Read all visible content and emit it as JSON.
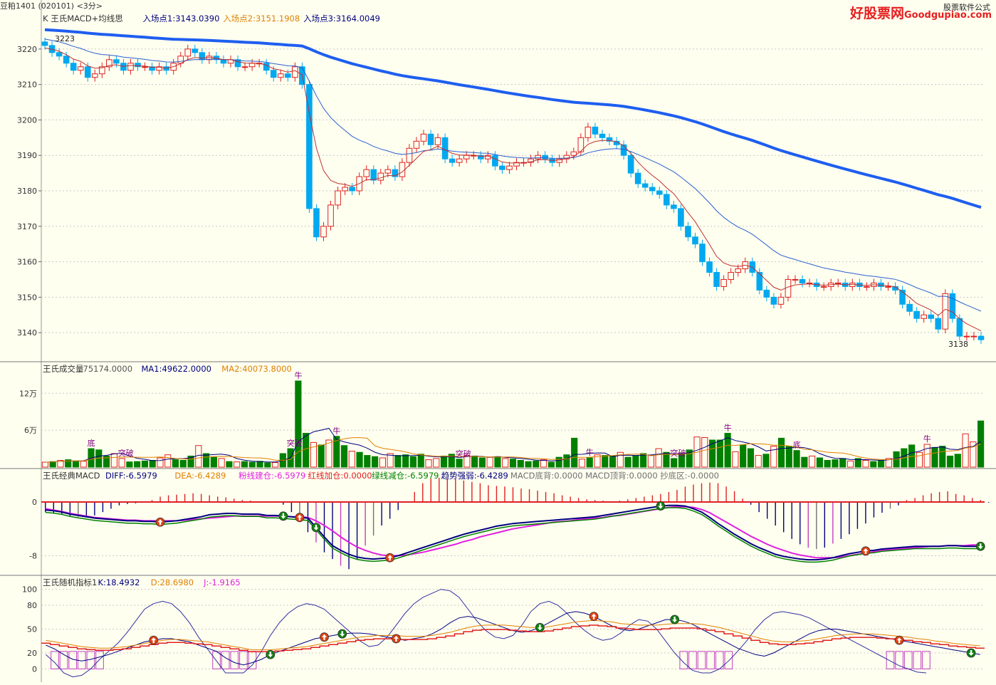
{
  "header": {
    "symbol": "豆粕1401",
    "code": "(020101)",
    "period": "<3分>",
    "watermark_brand": "好股票网",
    "watermark_url": "Goodgupiao.com",
    "watermark_sub": "股票软件公式"
  },
  "colors": {
    "up": "#e02020",
    "down": "#00a8f0",
    "volume_down": "#008000",
    "ma_long": "#1e5ef0",
    "ma_mid": "#2a5fd0",
    "ma_short": "#c03030",
    "grid": "#c8c8c8",
    "pink": "#e020e0",
    "orange": "#e08000",
    "navy": "#000080",
    "purple": "#c040c0"
  },
  "panels": {
    "price": {
      "title": "K  王氏MACD+均线思",
      "legend": [
        {
          "text": "入场点1:3143.0390",
          "color": "#000080"
        },
        {
          "text": "入场点2:3151.1908",
          "color": "#e08000"
        },
        {
          "text": "入场点3:3164.0049",
          "color": "#000080"
        }
      ],
      "yticks": [
        "3220",
        "3210",
        "3200",
        "3190",
        "3180",
        "3170",
        "3160",
        "3150",
        "3140"
      ],
      "high_label": "3223",
      "low_label": "3138"
    },
    "volume": {
      "title": "王氏成交量",
      "legend": [
        {
          "text": "75174.0000",
          "color": "#555555"
        },
        {
          "text": "MA1:49622.0000",
          "color": "#000080"
        },
        {
          "text": "MA2:40073.8000",
          "color": "#e08000"
        }
      ],
      "yticks": [
        "12万",
        "6万"
      ]
    },
    "macd": {
      "title": "王氏经典MACD",
      "legend": [
        {
          "text": "DIFF:-6.5979",
          "color": "#000080"
        },
        {
          "text": "DEA:-6.4289",
          "color": "#e08000"
        },
        {
          "text": "粉线建仓:-6.5979",
          "color": "#e020e0"
        },
        {
          "text": "红线加仓:0.0000",
          "color": "#e02020"
        },
        {
          "text": "绿线减仓:-6.5979",
          "color": "#008000"
        },
        {
          "text": "趋势强弱:-6.4289",
          "color": "#000080"
        },
        {
          "text": "MACD底背:0.0000",
          "color": "#707070"
        },
        {
          "text": "MACD顶背:0.0000",
          "color": "#707070"
        },
        {
          "text": "抄底区:-0.0000",
          "color": "#707070"
        }
      ],
      "yticks": [
        "0",
        "-8"
      ]
    },
    "kdj": {
      "title": "王氏随机指标1",
      "legend": [
        {
          "text": "K:18.4932",
          "color": "#000080"
        },
        {
          "text": "D:28.6980",
          "color": "#e08000"
        },
        {
          "text": "J:-1.9165",
          "color": "#e020e0"
        }
      ],
      "yticks": [
        "100",
        "80",
        "50",
        "20",
        "0"
      ]
    }
  },
  "signals": {
    "price_labels": [],
    "volume_labels": [
      "底",
      "牛",
      "牛",
      "突破",
      "突破",
      "突破",
      "突破",
      "牛",
      "牛",
      "底",
      "牛"
    ]
  },
  "chart_data": [
    {
      "type": "candlestick",
      "title": "",
      "ylim": [
        3133,
        3227
      ],
      "ylabel": "",
      "ticks": [
        3220,
        3210,
        3200,
        3190,
        3180,
        3170,
        3160,
        3150,
        3140
      ],
      "max_price": 3223,
      "min_price": 3138,
      "closes": [
        3221,
        3219,
        3218,
        3216,
        3214,
        3215,
        3212,
        3213,
        3215,
        3217,
        3216,
        3214,
        3216,
        3215,
        3215,
        3214,
        3215,
        3214,
        3216,
        3218,
        3220,
        3219,
        3217,
        3218,
        3217,
        3216,
        3217,
        3215,
        3215,
        3216,
        3216,
        3214,
        3212,
        3213,
        3212,
        3215,
        3210,
        3175,
        3167,
        3170,
        3176,
        3180,
        3181,
        3180,
        3184,
        3186,
        3183,
        3185,
        3186,
        3184,
        3188,
        3192,
        3194,
        3196,
        3193,
        3195,
        3189,
        3188,
        3189,
        3190,
        3190,
        3189,
        3190,
        3187,
        3186,
        3187,
        3188,
        3188,
        3189,
        3190,
        3189,
        3188,
        3189,
        3190,
        3191,
        3195,
        3198,
        3196,
        3195,
        3194,
        3193,
        3190,
        3185,
        3182,
        3181,
        3180,
        3179,
        3176,
        3175,
        3170,
        3167,
        3165,
        3160,
        3157,
        3153,
        3155,
        3157,
        3158,
        3160,
        3157,
        3152,
        3150,
        3148,
        3150,
        3155,
        3155,
        3154,
        3154,
        3153,
        3153,
        3154,
        3154,
        3153,
        3154,
        3153,
        3153,
        3154,
        3153,
        3153,
        3152,
        3148,
        3146,
        3144,
        3145,
        3144,
        3141,
        3151,
        3144,
        3139,
        3139,
        3139,
        3138
      ]
    },
    {
      "type": "bar",
      "title": "王氏成交量",
      "ylim": [
        0,
        155000
      ],
      "values": [
        8000,
        9000,
        11000,
        12000,
        10000,
        9500,
        30000,
        28000,
        18000,
        22000,
        14000,
        8500,
        9000,
        10000,
        11000,
        15000,
        20000,
        12000,
        11000,
        18000,
        35000,
        22000,
        16000,
        14000,
        9000,
        8500,
        9000,
        8000,
        9500,
        7000,
        7500,
        22000,
        30000,
        140000,
        55000,
        40000,
        36000,
        44000,
        50000,
        35000,
        26000,
        24000,
        19000,
        17000,
        15000,
        22000,
        19000,
        20000,
        17000,
        21000,
        12000,
        14000,
        18000,
        21000,
        13000,
        19000,
        18000,
        15000,
        16000,
        17000,
        14000,
        13000,
        11000,
        9000,
        10000,
        12000,
        8000,
        16000,
        20000,
        47000,
        13000,
        15000,
        20000,
        19000,
        18000,
        24000,
        16000,
        18000,
        22000,
        19000,
        30000,
        24000,
        14000,
        22000,
        28000,
        49000,
        48000,
        44000,
        44000,
        55000,
        25000,
        36000,
        30000,
        19000,
        21000,
        34000,
        47000,
        34000,
        27000,
        16000,
        18000,
        15000,
        11000,
        12000,
        14000,
        10000,
        14000,
        11000,
        9000,
        11000,
        14000,
        25000,
        30000,
        36000,
        24000,
        37000,
        32000,
        34000,
        18000,
        21000,
        54000,
        41000,
        75000
      ]
    },
    {
      "type": "line",
      "title": "王氏经典MACD",
      "ylim": [
        -10.5,
        3.5
      ],
      "series": [
        {
          "name": "DIFF",
          "values": [
            -1.2,
            -1.3,
            -1.5,
            -1.8,
            -2.0,
            -2.2,
            -2.4,
            -2.5,
            -2.6,
            -2.7,
            -2.8,
            -2.8,
            -2.9,
            -2.9,
            -3.0,
            -2.9,
            -2.8,
            -2.6,
            -2.4,
            -2.2,
            -1.9,
            -1.8,
            -1.7,
            -1.7,
            -1.8,
            -1.8,
            -1.8,
            -2.0,
            -2.0,
            -2.1,
            -2.2,
            -2.3,
            -2.4,
            -3.8,
            -5.2,
            -6.5,
            -7.2,
            -7.8,
            -8.2,
            -8.4,
            -8.5,
            -8.4,
            -8.3,
            -8.0,
            -7.6,
            -7.2,
            -6.8,
            -6.4,
            -6.0,
            -5.6,
            -5.2,
            -4.8,
            -4.5,
            -4.2,
            -3.9,
            -3.6,
            -3.4,
            -3.2,
            -3.1,
            -3.0,
            -2.9,
            -2.8,
            -2.7,
            -2.6,
            -2.5,
            -2.4,
            -2.3,
            -2.2,
            -2.0,
            -1.8,
            -1.6,
            -1.4,
            -1.2,
            -1.0,
            -0.8,
            -0.6,
            -0.5,
            -0.5,
            -0.6,
            -1.0,
            -1.5,
            -2.3,
            -3.2,
            -4.0,
            -4.8,
            -5.5,
            -6.2,
            -6.8,
            -7.3,
            -7.8,
            -8.1,
            -8.3,
            -8.5,
            -8.6,
            -8.6,
            -8.5,
            -8.3,
            -8.0,
            -7.7,
            -7.5,
            -7.3,
            -7.2,
            -7.0,
            -6.9,
            -6.8,
            -6.7,
            -6.6,
            -6.6,
            -6.6,
            -6.6,
            -6.5,
            -6.5,
            -6.6,
            -6.6,
            -6.6
          ]
        },
        {
          "name": "DEA",
          "values": [
            -1.0,
            -1.2,
            -1.4,
            -1.7,
            -1.9,
            -2.1,
            -2.3,
            -2.4,
            -2.5,
            -2.6,
            -2.7,
            -2.7,
            -2.8,
            -2.8,
            -2.8,
            -2.8,
            -2.8,
            -2.7,
            -2.6,
            -2.5,
            -2.4,
            -2.3,
            -2.2,
            -2.1,
            -2.1,
            -2.1,
            -2.1,
            -2.1,
            -2.1,
            -2.1,
            -2.2,
            -2.2,
            -2.3,
            -2.8,
            -3.5,
            -4.3,
            -5.2,
            -6.0,
            -6.7,
            -7.2,
            -7.6,
            -7.9,
            -8.0,
            -8.0,
            -7.9,
            -7.7,
            -7.5,
            -7.2,
            -6.9,
            -6.6,
            -6.3,
            -5.9,
            -5.6,
            -5.2,
            -4.9,
            -4.6,
            -4.3,
            -4.0,
            -3.8,
            -3.6,
            -3.4,
            -3.2,
            -3.0,
            -2.9,
            -2.8,
            -2.6,
            -2.5,
            -2.4,
            -2.3,
            -2.1,
            -2.0,
            -1.8,
            -1.6,
            -1.4,
            -1.2,
            -1.0,
            -0.8,
            -0.7,
            -0.7,
            -0.8,
            -1.1,
            -1.6,
            -2.3,
            -3.0,
            -3.7,
            -4.4,
            -5.1,
            -5.7,
            -6.3,
            -6.8,
            -7.2,
            -7.6,
            -7.9,
            -8.1,
            -8.3,
            -8.3,
            -8.3,
            -8.2,
            -8.0,
            -7.8,
            -7.6,
            -7.4,
            -7.2,
            -7.1,
            -7.0,
            -6.9,
            -6.8,
            -6.7,
            -6.6,
            -6.6,
            -6.5,
            -6.5,
            -6.5,
            -6.4,
            -6.4
          ]
        },
        {
          "name": "MACD柱",
          "values": [
            -1.5,
            -1.7,
            -1.9,
            -2.1,
            -2.2,
            -2.3,
            -2.0,
            -1.5,
            -1.0,
            -0.5,
            -0.3,
            -0.2,
            0.1,
            0.3,
            0.8,
            1.0,
            1.1,
            1.2,
            1.3,
            1.2,
            1.0,
            0.8,
            0.7,
            0.5,
            0.3,
            0.2,
            0.1,
            0.1,
            -0.1,
            -0.4,
            -1.5,
            -3.0,
            -4.5,
            -6.0,
            -7.5,
            -8.5,
            -9.5,
            -10.0,
            -8.5,
            -6.5,
            -5.0,
            -3.5,
            -2.5,
            -1.2,
            -0.1,
            1.5,
            2.8,
            3.5,
            3.6,
            3.5,
            3.4,
            3.2,
            3.0,
            2.8,
            2.5,
            2.4,
            2.3,
            2.2,
            2.0,
            1.9,
            1.7,
            1.5,
            1.3,
            1.0,
            0.8,
            0.6,
            0.4,
            0.3,
            0.2,
            0.1,
            0.2,
            0.4,
            0.6,
            0.8,
            1.0,
            1.2,
            1.5,
            1.8,
            2.3,
            2.6,
            2.8,
            2.9,
            2.8,
            2.3,
            1.6,
            0.5,
            -0.4,
            -1.5,
            -2.5,
            -3.5,
            -4.5,
            -5.5,
            -6.3,
            -6.8,
            -7.0,
            -6.8,
            -6.2,
            -5.5,
            -4.8,
            -4.0,
            -3.2,
            -2.3,
            -1.6,
            -1.0,
            -0.5,
            0.3,
            0.6,
            1.0,
            1.3,
            1.5,
            1.6,
            1.2,
            1.0,
            0.6,
            0.3,
            -0.1,
            -0.1,
            -0.2,
            -0.2,
            -0.3,
            -0.2
          ]
        }
      ]
    },
    {
      "type": "line",
      "title": "王氏随机指标1",
      "ylim": [
        -5,
        105
      ],
      "series": [
        {
          "name": "K",
          "values": [
            30,
            25,
            18,
            12,
            10,
            12,
            15,
            18,
            22,
            26,
            30,
            34,
            36,
            38,
            38,
            36,
            34,
            30,
            26,
            22,
            14,
            8,
            5,
            8,
            12,
            18,
            22,
            26,
            30,
            34,
            38,
            40,
            42,
            44,
            45,
            45,
            44,
            42,
            40,
            38,
            36,
            38,
            40,
            44,
            50,
            58,
            64,
            66,
            64,
            60,
            56,
            52,
            48,
            46,
            48,
            52,
            58,
            64,
            70,
            72,
            70,
            66,
            60,
            54,
            50,
            48,
            50,
            54,
            58,
            62,
            62,
            60,
            56,
            50,
            44,
            38,
            32,
            26,
            22,
            18,
            16,
            20,
            26,
            32,
            38,
            44,
            48,
            50,
            50,
            48,
            46,
            44,
            42,
            40,
            38,
            36,
            34,
            32,
            30,
            28,
            26,
            24,
            22,
            20,
            18
          ]
        },
        {
          "name": "D",
          "values": [
            36,
            34,
            32,
            30,
            28,
            27,
            26,
            26,
            27,
            28,
            30,
            32,
            34,
            36,
            37,
            37,
            36,
            35,
            34,
            32,
            30,
            28,
            26,
            24,
            24,
            24,
            25,
            26,
            27,
            28,
            30,
            32,
            34,
            36,
            38,
            40,
            41,
            42,
            42,
            42,
            41,
            41,
            41,
            42,
            44,
            46,
            49,
            52,
            54,
            55,
            55,
            55,
            54,
            53,
            52,
            52,
            53,
            55,
            57,
            59,
            60,
            61,
            60,
            59,
            57,
            56,
            55,
            55,
            55,
            56,
            57,
            57,
            57,
            56,
            54,
            52,
            49,
            46,
            43,
            40,
            37,
            35,
            34,
            34,
            35,
            36,
            38,
            40,
            42,
            43,
            44,
            44,
            44,
            43,
            42,
            41,
            40,
            38,
            37,
            35,
            34,
            32,
            31,
            30,
            29
          ]
        },
        {
          "name": "J",
          "values": [
            18,
            8,
            -5,
            -10,
            -8,
            0,
            12,
            22,
            32,
            45,
            60,
            75,
            82,
            85,
            82,
            72,
            58,
            40,
            25,
            10,
            -5,
            -5,
            -5,
            5,
            22,
            42,
            58,
            70,
            78,
            82,
            80,
            75,
            65,
            55,
            45,
            35,
            28,
            30,
            40,
            55,
            70,
            82,
            90,
            95,
            100,
            98,
            90,
            75,
            60,
            48,
            40,
            38,
            42,
            55,
            72,
            82,
            85,
            80,
            70,
            58,
            48,
            40,
            36,
            38,
            45,
            55,
            62,
            60,
            50,
            35,
            20,
            8,
            -2,
            -5,
            -5,
            0,
            10,
            22,
            35,
            50,
            62,
            70,
            72,
            70,
            68,
            64,
            58,
            52,
            46,
            40,
            34,
            28,
            22,
            16,
            10,
            4,
            0,
            -4,
            -5
          ]
        }
      ]
    }
  ]
}
